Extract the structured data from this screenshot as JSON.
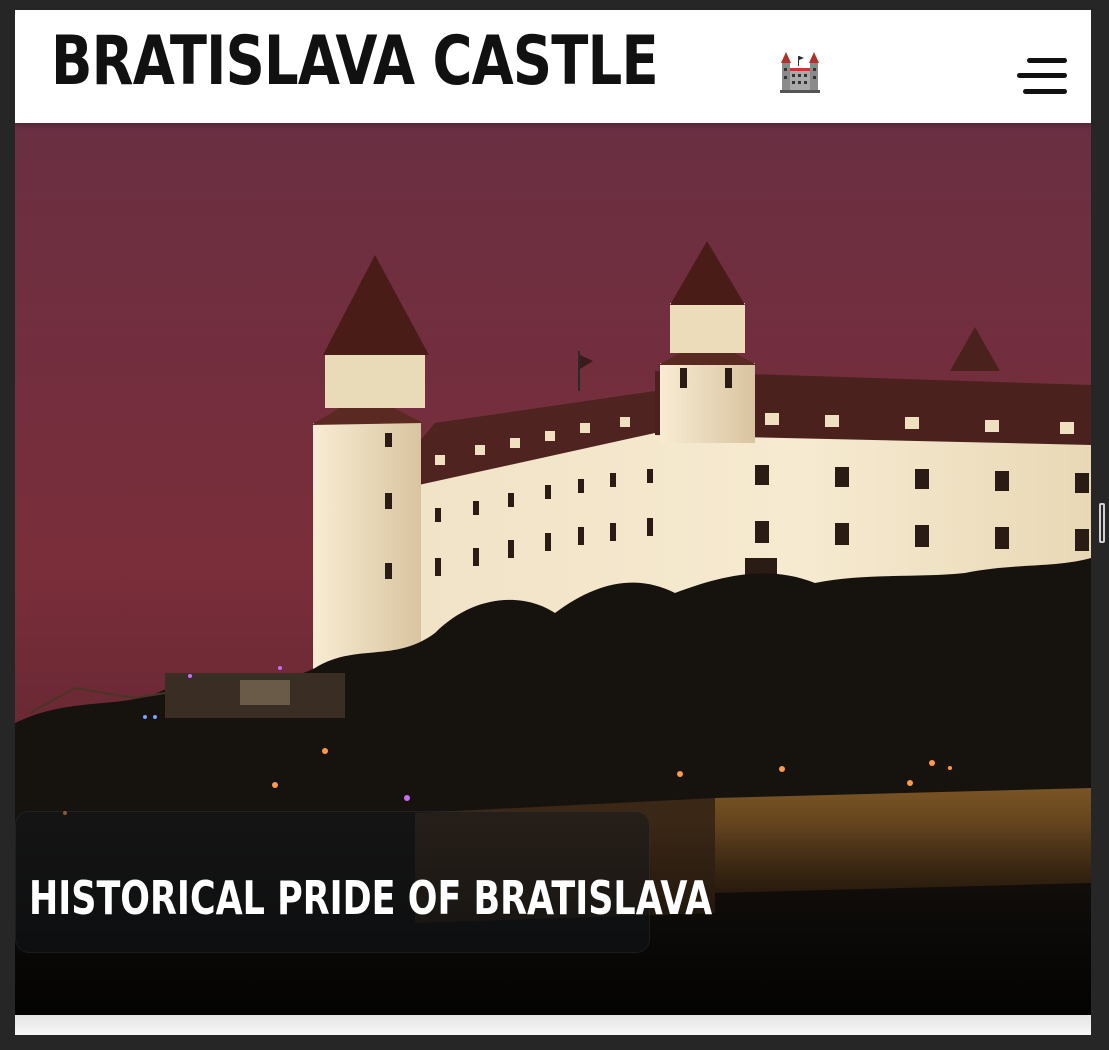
{
  "header": {
    "site_title": "BRATISLAVA CASTLE",
    "logo_icon": "castle-icon",
    "menu_icon": "hamburger-menu-icon"
  },
  "hero": {
    "caption": "HISTORICAL PRIDE OF BRATISLAVA",
    "image_alt_icon": "castle-photo"
  },
  "colors": {
    "page_background": "#262626",
    "header_background": "#ffffff",
    "title_text": "#111111",
    "sky": "#5e2c3d",
    "castle_wall": "#eadcbf",
    "roof": "#4a1d1d",
    "caption_text": "#ffffff"
  }
}
